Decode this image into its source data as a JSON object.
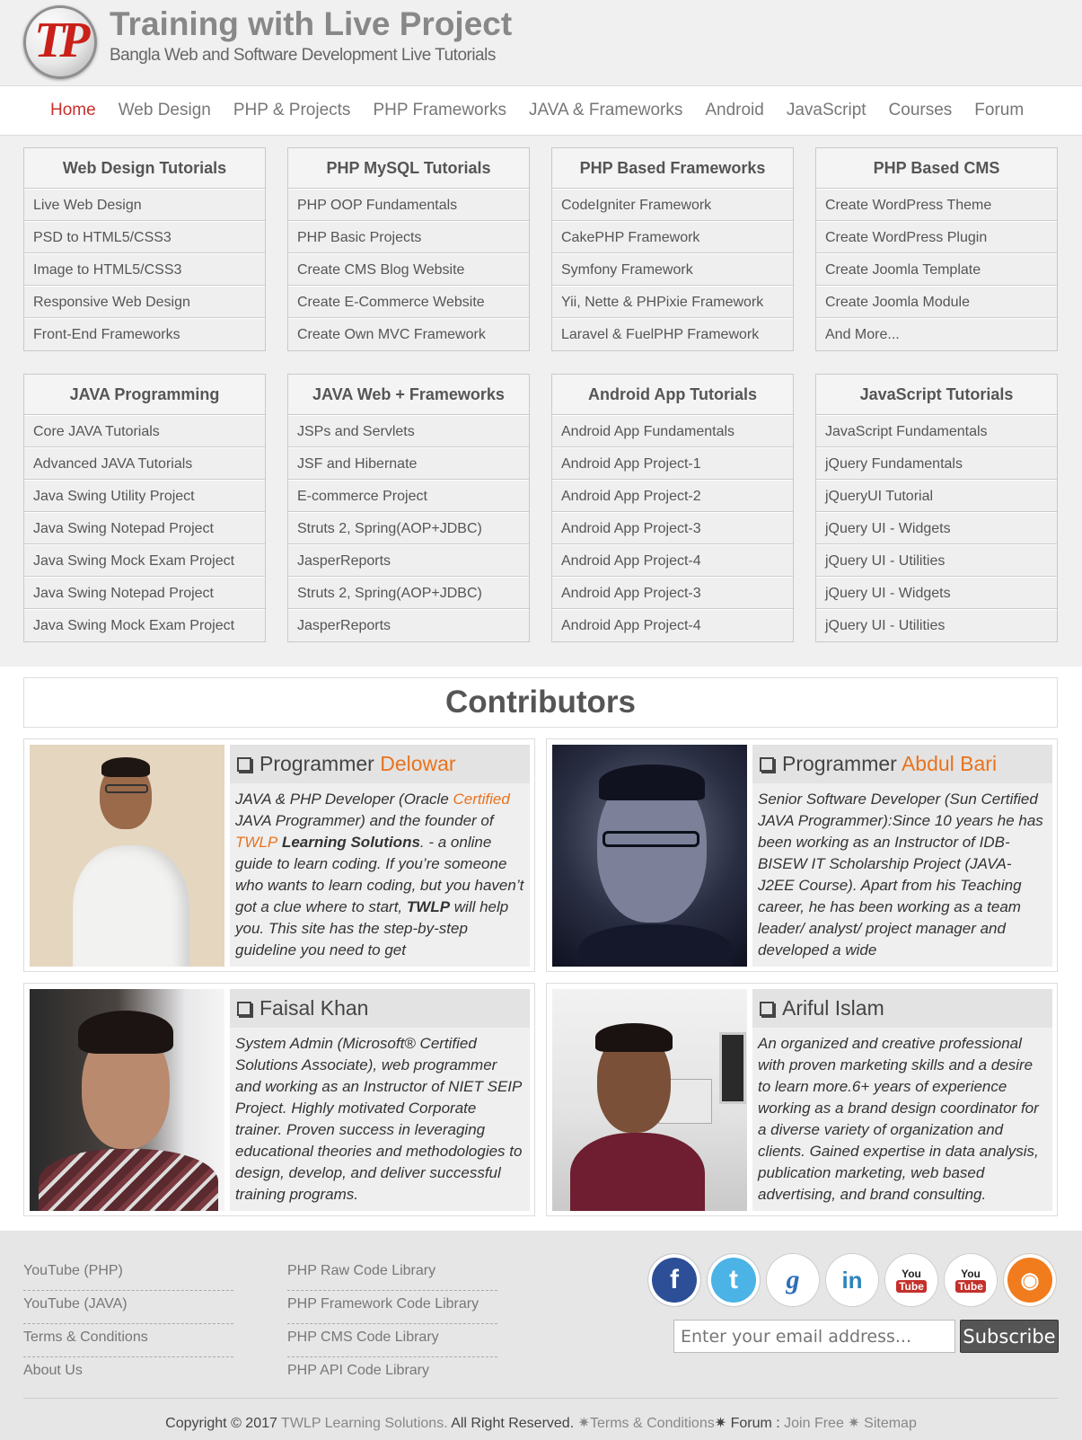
{
  "header": {
    "logo_text": "TP",
    "title": "Training with Live Project",
    "subtitle": "Bangla Web and Software Development Live Tutorials"
  },
  "nav": [
    "Home",
    "Web Design",
    "PHP & Projects",
    "PHP Frameworks",
    "JAVA & Frameworks",
    "Android",
    "JavaScript",
    "Courses",
    "Forum"
  ],
  "boxes_row1": [
    {
      "title": "Web Design Tutorials",
      "items": [
        "Live Web Design",
        "PSD to HTML5/CSS3",
        "Image to HTML5/CSS3",
        "Responsive Web Design",
        "Front-End Frameworks"
      ]
    },
    {
      "title": "PHP MySQL Tutorials",
      "items": [
        "PHP OOP Fundamentals",
        "PHP Basic Projects",
        "Create CMS Blog Website",
        "Create E-Commerce Website",
        "Create Own MVC Framework"
      ]
    },
    {
      "title": "PHP Based Frameworks",
      "items": [
        "CodeIgniter Framework",
        "CakePHP Framework",
        "Symfony Framework",
        "Yii, Nette & PHPixie Framework",
        "Laravel & FuelPHP Framework"
      ]
    },
    {
      "title": "PHP Based CMS",
      "items": [
        "Create WordPress Theme",
        "Create WordPress Plugin",
        "Create Joomla Template",
        "Create Joomla Module",
        "And More..."
      ]
    }
  ],
  "boxes_row2": [
    {
      "title": "JAVA Programming",
      "items": [
        "Core JAVA Tutorials",
        "Advanced JAVA Tutorials",
        "Java Swing Utility Project",
        "Java Swing Notepad Project",
        "Java Swing Mock Exam Project",
        "Java Swing Notepad Project",
        "Java Swing Mock Exam Project"
      ]
    },
    {
      "title": "JAVA Web + Frameworks",
      "items": [
        "JSPs and Servlets",
        "JSF and Hibernate",
        "E-commerce Project",
        "Struts 2, Spring(AOP+JDBC)",
        "JasperReports",
        "Struts 2, Spring(AOP+JDBC)",
        "JasperReports"
      ]
    },
    {
      "title": "Android App Tutorials",
      "items": [
        "Android App Fundamentals",
        "Android App Project-1",
        "Android App Project-2",
        "Android App Project-3",
        "Android App Project-4",
        "Android App Project-3",
        "Android App Project-4"
      ]
    },
    {
      "title": "JavaScript Tutorials",
      "items": [
        "JavaScript Fundamentals",
        "jQuery Fundamentals",
        "jQueryUI Tutorial",
        "jQuery UI - Widgets",
        "jQuery UI - Utilities",
        "jQuery UI - Widgets",
        "jQuery UI - Utilities"
      ]
    }
  ],
  "contributors": {
    "heading": "Contributors",
    "c1": {
      "name_prefix": "Programmer ",
      "name_hl": "Delowar",
      "d1": "JAVA & PHP Developer (Oracle ",
      "d1_hl": "Certified",
      "d2": " JAVA Programmer) and the founder of ",
      "d3_hl": "TWLP",
      "d3_b": " Learning Solutions",
      "d4": ". - a online guide to learn coding. If you’re someone who wants to learn coding, but you haven’t got a clue where to start, ",
      "d5_b": "TWLP",
      "d6": " will help you. This site has the step-by-step guideline you need to get"
    },
    "c2": {
      "name_prefix": "Programmer ",
      "name_hl": "Abdul Bari",
      "desc": "Senior Software Developer (Sun Certified JAVA Programmer):Since 10 years he has been working as an Instructor of IDB-BISEW IT Scholarship Project (JAVA- J2EE Course). Apart from his Teaching career, he has been working as a team leader/ analyst/ project manager and developed a wide"
    },
    "c3": {
      "name": "Faisal Khan",
      "desc": "System Admin (Microsoft® Certified Solutions Associate), web programmer and working as an Instructor of NIET SEIP Project. Highly motivated Corporate trainer. Proven success in leveraging educational theories and methodologies to design, develop, and deliver successful training programs."
    },
    "c4": {
      "name": "Ariful Islam",
      "desc": "An organized and creative professional with proven marketing skills and a desire to learn more.6+ years of experience working as a brand design coordinator for a diverse variety of organization and clients. Gained expertise in data analysis, publication marketing, web based advertising, and brand consulting."
    }
  },
  "footer": {
    "col1": [
      "YouTube (PHP)",
      "YouTube (JAVA)",
      "Terms & Conditions",
      "About Us"
    ],
    "col2": [
      "PHP Raw Code Library",
      "PHP Framework Code Library",
      "PHP CMS Code Library",
      "PHP API Code Library"
    ],
    "social": [
      "facebook-icon",
      "twitter-icon",
      "googleplus-icon",
      "linkedin-icon",
      "youtube-icon",
      "youtube-icon",
      "rss-icon"
    ],
    "email_placeholder": "Enter your email address...",
    "subscribe_label": "Subscribe",
    "copy1": "Copyright © 2017 ",
    "copy_brand": "TWLP Learning Solutions.",
    "copy2": " All Right Reserved. ",
    "copy_terms": "✷Terms & Conditions",
    "copy_forum": "✷ Forum : ",
    "copy_join": "Join Free",
    "copy_sitemap": " ✷ Sitemap"
  },
  "colors": {
    "accent": "#e8731d",
    "nav_active": "#c9302c"
  }
}
